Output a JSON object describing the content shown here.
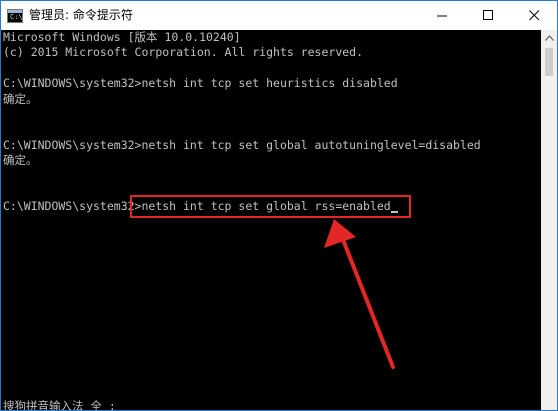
{
  "window": {
    "title": "管理员: 命令提示符",
    "icon": "cmd-icon",
    "controls": {
      "minimize": "—",
      "maximize": "☐",
      "close": "✕"
    }
  },
  "console": {
    "lines": [
      "Microsoft Windows [版本 10.0.10240]",
      "(c) 2015 Microsoft Corporation. All rights reserved.",
      "",
      "C:\\WINDOWS\\system32>netsh int tcp set heuristics disabled",
      "确定。",
      "",
      "",
      "C:\\WINDOWS\\system32>netsh int tcp set global autotuninglevel=disabled",
      "确定。",
      "",
      "",
      "C:\\WINDOWS\\system32>netsh int tcp set global rss=enabled",
      "",
      "",
      "",
      "",
      "",
      "",
      "",
      "",
      "",
      "",
      "",
      "",
      "搜狗拼音输入法 全 :"
    ]
  },
  "annotation": {
    "color": "#e32626"
  }
}
